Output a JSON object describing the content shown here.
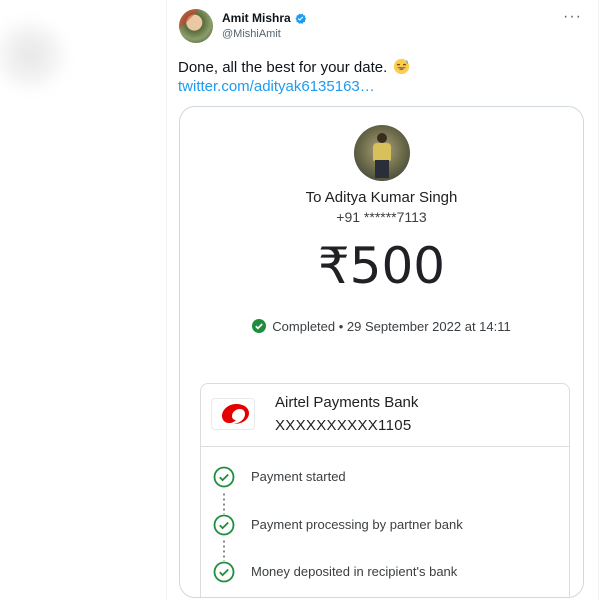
{
  "tweet": {
    "author_name": "Amit Mishra",
    "handle": "@MishiAmit",
    "text": "Done, all the best for your date.",
    "link": "twitter.com/adityak6135163…",
    "more_icon": "more-icon",
    "verified_icon": "verified-icon",
    "emoji": "sweat-smile-emoji"
  },
  "payment": {
    "recipient": "To Aditya Kumar Singh",
    "phone": "+91 ******7113",
    "amount": "₹500",
    "status": "Completed • 29 September 2022 at 14:11",
    "bank_name": "Airtel Payments Bank",
    "account": "XXXXXXXXXX1105",
    "steps": [
      {
        "label": "Payment started"
      },
      {
        "label": "Payment processing by partner bank"
      },
      {
        "label": "Money deposited in recipient's bank"
      }
    ]
  },
  "colors": {
    "link": "#1d9bf0",
    "success": "#1e8e3e",
    "airtel_red": "#e40000",
    "verified": "#1d9bf0"
  }
}
